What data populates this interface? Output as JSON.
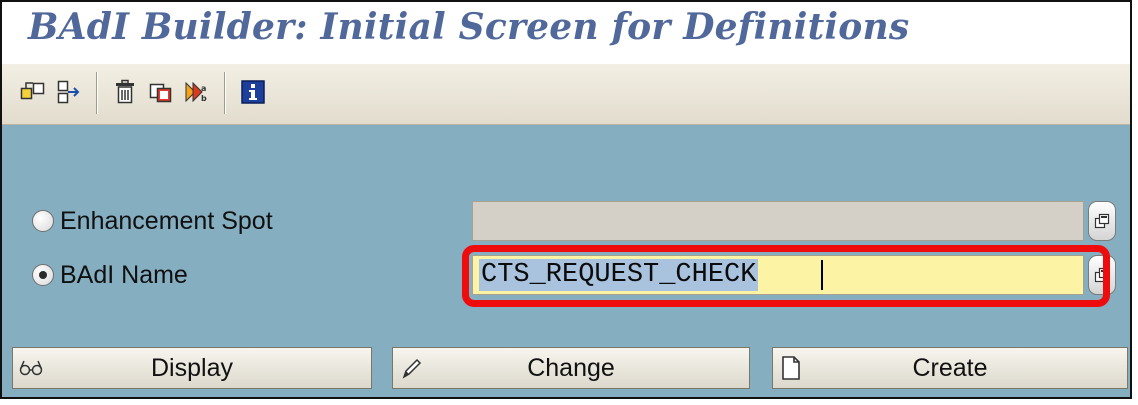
{
  "window": {
    "title": "BAdI Builder: Initial Screen for Definitions"
  },
  "toolbar": {
    "icons": [
      "other-object-icon",
      "where-used-icon",
      "delete-icon",
      "copy-icon",
      "rename-icon",
      "information-icon"
    ]
  },
  "form": {
    "enhancement_spot": {
      "label": "Enhancement Spot",
      "value": "",
      "selected": false
    },
    "badi_name": {
      "label": "BAdI Name",
      "value": "CTS_REQUEST_CHECK",
      "selected": true
    }
  },
  "buttons": {
    "display": "Display",
    "change": "Change",
    "create": "Create"
  },
  "colors": {
    "title": "#51689b",
    "content_bg": "#85aec0",
    "active_input": "#fdf3a5",
    "highlight": "#ee0c0c"
  }
}
